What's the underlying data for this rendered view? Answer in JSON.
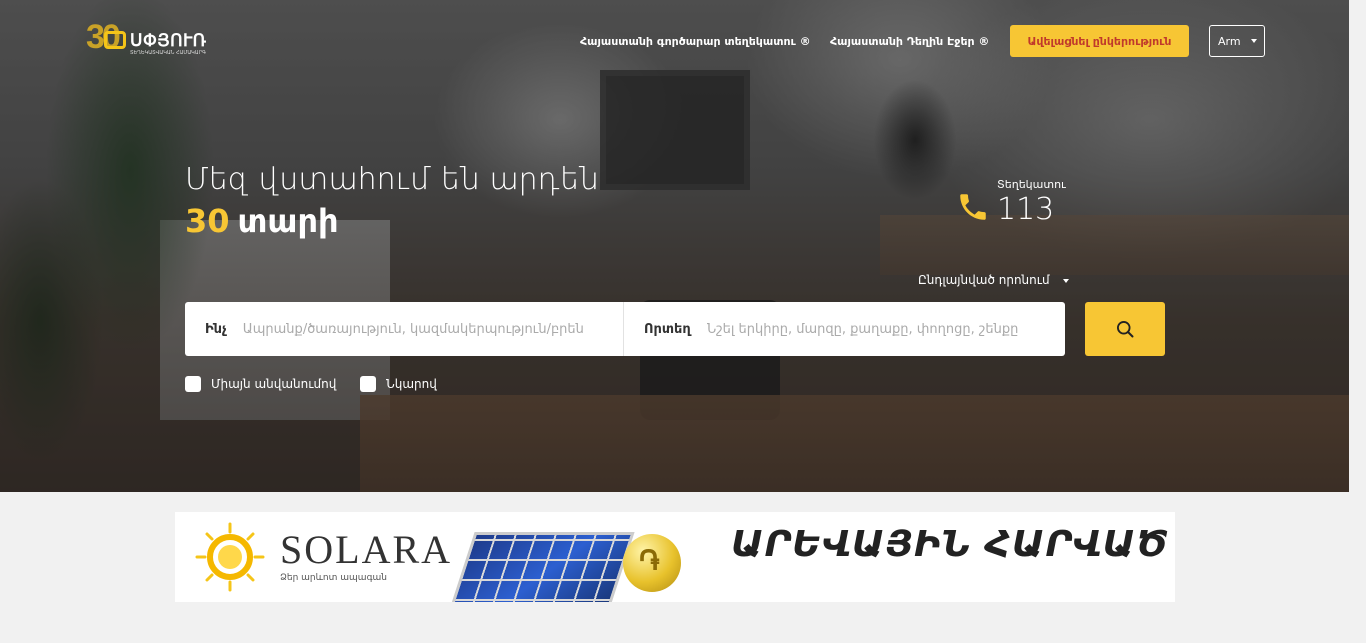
{
  "brand": {
    "number": "30",
    "name": "ՍՓՅՈՒՌ",
    "tagline": "ՏԵՂԵԿԱՏՎԱԿԱՆ ՀԱՄԱԿԱՐԳ",
    "colors": {
      "accent": "#f7c634",
      "cta_text": "#c0392b"
    }
  },
  "nav": {
    "link1": "Հայաստանի գործարար տեղեկատու ®",
    "link2": "Հայաստանի Դեղին Էջեր ®",
    "add_company": "Ավելացնել ընկերություն",
    "language": "Arm"
  },
  "hero": {
    "headline": "Մեզ վստահում են արդեն",
    "years": "30",
    "years_word": "տարի"
  },
  "info": {
    "label": "Տեղեկատու",
    "number": "113",
    "icon": "phone-icon"
  },
  "search": {
    "advanced": "Ընդլայնված որոնում",
    "what_label": "Ինչ",
    "what_placeholder": "Ապրանք/ծառայություն, կազմակերպություն/բրեն",
    "where_label": "Որտեղ",
    "where_placeholder": "Նշել երկիրը, մարզը, քաղաքը, փողոցը, շենքը",
    "button_icon": "search-icon"
  },
  "filters": {
    "by_name": "Միայն անվանումով",
    "with_photo": "Նկարով"
  },
  "banner": {
    "brand": "SOLARA",
    "tagline": "Ձեր արևոտ ապագան",
    "headline": "ԱՐԵՎԱՅԻՆ ՀԱՐՎԱԾ",
    "coin_symbol": "֏"
  }
}
